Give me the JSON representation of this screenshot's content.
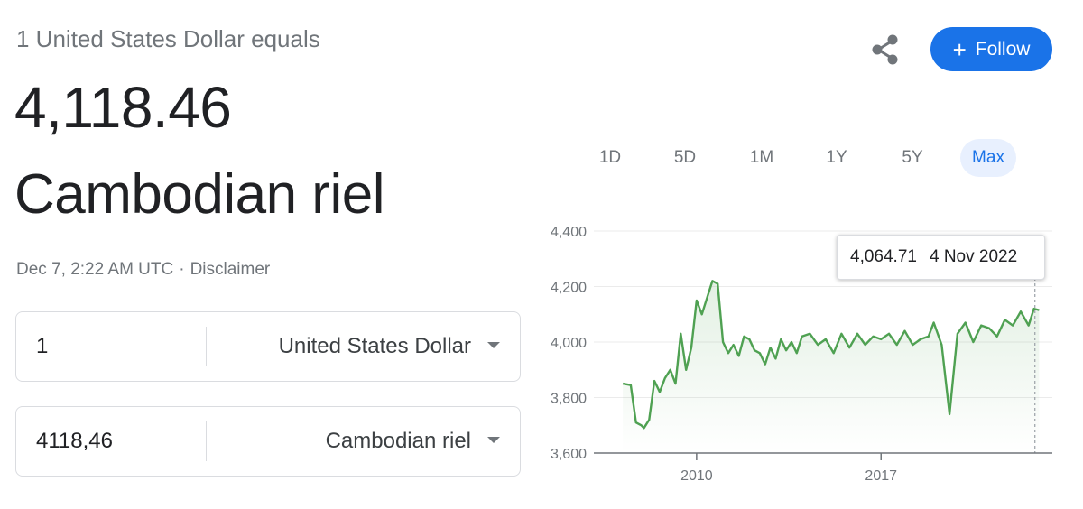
{
  "header": {
    "equals_text": "1 United States Dollar equals",
    "amount": "4,118.46",
    "currency_name": "Cambodian riel",
    "timestamp": "Dec 7, 2:22 AM UTC",
    "separator": "·",
    "disclaimer": "Disclaimer"
  },
  "actions": {
    "share_icon": "share-icon",
    "follow_label": "Follow",
    "follow_icon": "+",
    "accent": "#1a73e8"
  },
  "converter": {
    "from": {
      "value": "1",
      "currency": "United States Dollar"
    },
    "to": {
      "value": "4118,46",
      "currency": "Cambodian riel"
    }
  },
  "ranges": [
    {
      "label": "1D",
      "active": false
    },
    {
      "label": "5D",
      "active": false
    },
    {
      "label": "1M",
      "active": false
    },
    {
      "label": "1Y",
      "active": false
    },
    {
      "label": "5Y",
      "active": false
    },
    {
      "label": "Max",
      "active": true
    }
  ],
  "tooltip": {
    "value": "4,064.71",
    "date": "4 Nov 2022"
  },
  "chart_data": {
    "type": "area",
    "line_color": "#4fa152",
    "x": [
      2007.2,
      2007.5,
      2007.7,
      2007.9,
      2008.0,
      2008.2,
      2008.4,
      2008.6,
      2008.8,
      2009.0,
      2009.2,
      2009.4,
      2009.6,
      2009.8,
      2010.0,
      2010.2,
      2010.4,
      2010.6,
      2010.8,
      2011.0,
      2011.2,
      2011.4,
      2011.6,
      2011.8,
      2012.0,
      2012.2,
      2012.4,
      2012.6,
      2012.8,
      2013.0,
      2013.2,
      2013.4,
      2013.6,
      2013.8,
      2014.0,
      2014.3,
      2014.6,
      2014.9,
      2015.2,
      2015.5,
      2015.8,
      2016.1,
      2016.4,
      2016.7,
      2017.0,
      2017.3,
      2017.6,
      2017.9,
      2018.2,
      2018.5,
      2018.8,
      2019.0,
      2019.3,
      2019.6,
      2019.9,
      2020.2,
      2020.5,
      2020.8,
      2021.1,
      2021.4,
      2021.7,
      2022.0,
      2022.3,
      2022.6,
      2022.8,
      2023.0
    ],
    "values": [
      3850,
      3845,
      3710,
      3700,
      3690,
      3720,
      3860,
      3820,
      3870,
      3900,
      3850,
      4030,
      3900,
      3980,
      4150,
      4100,
      4160,
      4220,
      4210,
      4000,
      3960,
      3990,
      3950,
      4020,
      4010,
      3970,
      3960,
      3920,
      3980,
      3940,
      4010,
      3970,
      4000,
      3960,
      4020,
      4030,
      3990,
      4010,
      3960,
      4030,
      3980,
      4030,
      3990,
      4020,
      4010,
      4030,
      3990,
      4040,
      3990,
      4010,
      4020,
      4070,
      3990,
      3740,
      4030,
      4070,
      4000,
      4060,
      4050,
      4020,
      4080,
      4060,
      4110,
      4060,
      4120,
      4115
    ],
    "x_ticks": [
      "2010",
      "2017"
    ],
    "x_tick_values": [
      2010,
      2017
    ],
    "y_ticks": [
      "4,400",
      "4,200",
      "4,000",
      "3,800",
      "3,600"
    ],
    "y_tick_values": [
      4400,
      4200,
      4000,
      3800,
      3600
    ],
    "xlim": [
      2006.1,
      2023.5
    ],
    "ylim": [
      3600,
      4400
    ],
    "grid": true,
    "cursor_x": 2022.84
  }
}
